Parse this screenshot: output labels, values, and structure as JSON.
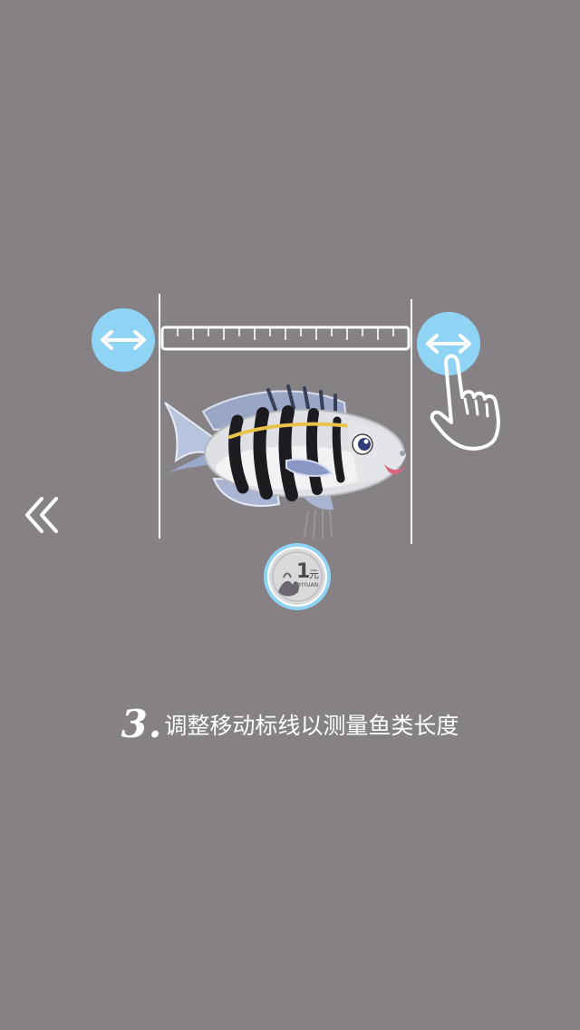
{
  "tutorial": {
    "step_number": "3.",
    "instruction": "调整移动标线以测量鱼类长度"
  },
  "coin": {
    "value_text": "1",
    "unit_text": "元",
    "pinyin_text": "YIYUAN"
  },
  "icons": {
    "back": "double-chevron-left-icon",
    "left_handle": "double-arrow-horizontal-icon",
    "right_handle": "double-arrow-horizontal-icon",
    "hand": "pointing-hand-icon",
    "ruler": "ruler-icon",
    "fish": "fish-illustration",
    "coin": "one-yuan-coin-icon"
  },
  "colors": {
    "background": "#858185",
    "accent": "#8fd4f4",
    "line": "#ffffff"
  }
}
